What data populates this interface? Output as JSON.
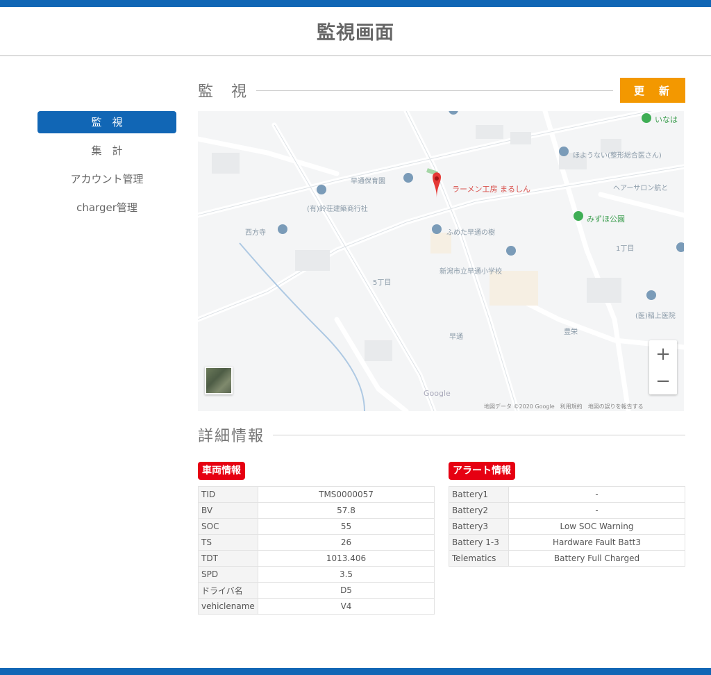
{
  "header": {
    "title": "監視画面"
  },
  "sidebar": {
    "items": [
      {
        "label": "監　視",
        "active": true
      },
      {
        "label": "集　計",
        "active": false
      },
      {
        "label": "アカウント管理",
        "active": false
      },
      {
        "label": "charger管理",
        "active": false
      }
    ]
  },
  "monitor": {
    "title": "監　視",
    "refresh_label": "更　新"
  },
  "map": {
    "labels": {
      "ramen": "ラーメン工房 まるしん",
      "nursery": "早通保育園",
      "company": "(有)鈴荘建築商行社",
      "temple": "西方寺",
      "shrine": "ふめた早通の樹",
      "school": "新潟市立早通小学校",
      "area5": "5丁目",
      "area1": "1丁目",
      "park": "みずほ公園",
      "salon": "ヘアーサロン航と",
      "hayadori": "早通",
      "station": "豊栄",
      "clinic": "ほようない(整形総合医さん)",
      "hospital": "(医)稲上医院",
      "inaba": "いなは"
    },
    "google": "Google",
    "attribution": "地図データ ©2020 Google　利用規約　地図の誤りを報告する"
  },
  "detail": {
    "title": "詳細情報"
  },
  "vehicle": {
    "badge": "車両情報",
    "rows": [
      {
        "key": "TID",
        "value": "TMS0000057"
      },
      {
        "key": "BV",
        "value": "57.8"
      },
      {
        "key": "SOC",
        "value": "55"
      },
      {
        "key": "TS",
        "value": "26"
      },
      {
        "key": "TDT",
        "value": "1013.406"
      },
      {
        "key": "SPD",
        "value": "3.5"
      },
      {
        "key": "ドライバ名",
        "value": "D5"
      },
      {
        "key": "vehiclename",
        "value": "V4"
      }
    ]
  },
  "alert": {
    "badge": "アラート情報",
    "rows": [
      {
        "key": "Battery1",
        "value": "-"
      },
      {
        "key": "Battery2",
        "value": "-"
      },
      {
        "key": "Battery3",
        "value": "Low SOC Warning"
      },
      {
        "key": "Battery 1-3",
        "value": "Hardware Fault Batt3"
      },
      {
        "key": "Telematics",
        "value": "Battery Full Charged"
      }
    ]
  },
  "colors": {
    "brand": "#1166b5",
    "accent": "#f39800",
    "alert": "#e60012"
  }
}
